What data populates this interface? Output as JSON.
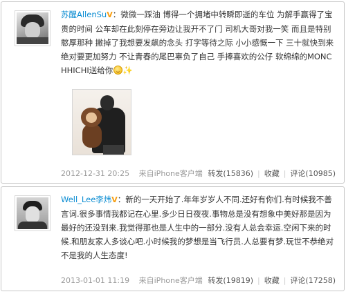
{
  "posts": [
    {
      "username": "苏醒AllenSu",
      "verified": "V",
      "text": "微微一踩油 博得一个拥堵中转瞬即逝的车位 为解手赢得了宝贵的时间 公车却在此刻停在旁边让我开不了门 司机大哥对我一笑 而且是特别憨厚那种 撇掉了我想要发飙的念头 打字等待之际 小小感慨一下 三十就快到来 绝对要更加努力 不让青春的尾巴辜负了自己 手捧喜欢的公仔 软绵绵的MONCHHICHI送给你",
      "emoticon": "smile-emoticon",
      "time": "2012-12-31 20:25",
      "source": "来自iPhone客户端",
      "repost": "转发(15836)",
      "favorite": "收藏",
      "comment": "评论(10985)"
    },
    {
      "username": "Well_Lee李炜",
      "verified": "V",
      "text": "新的一天开始了.年年岁岁人不同.还好有你们.有时候我不善言词.很多事情我都记在心里.多少日日夜夜.事物总是没有想象中美好那是因为最好的还没到来.我觉得那也是人生中的一部分.没有人总会幸运.空闲下来的时候.和朋友家人多谈心吧.小时候我的梦想是当飞行员.人总要有梦.玩世不恭绝对不是我的人生态度!",
      "time": "2013-01-01 11:19",
      "source": "来自iPhone客户端",
      "repost": "转发(19819)",
      "favorite": "收藏",
      "comment": "评论(17258)"
    }
  ],
  "colors": {
    "username": "#0a8cd2",
    "verified_badge": "#f79d0f",
    "meta_text": "#999999",
    "border": "#c6c6c6"
  }
}
